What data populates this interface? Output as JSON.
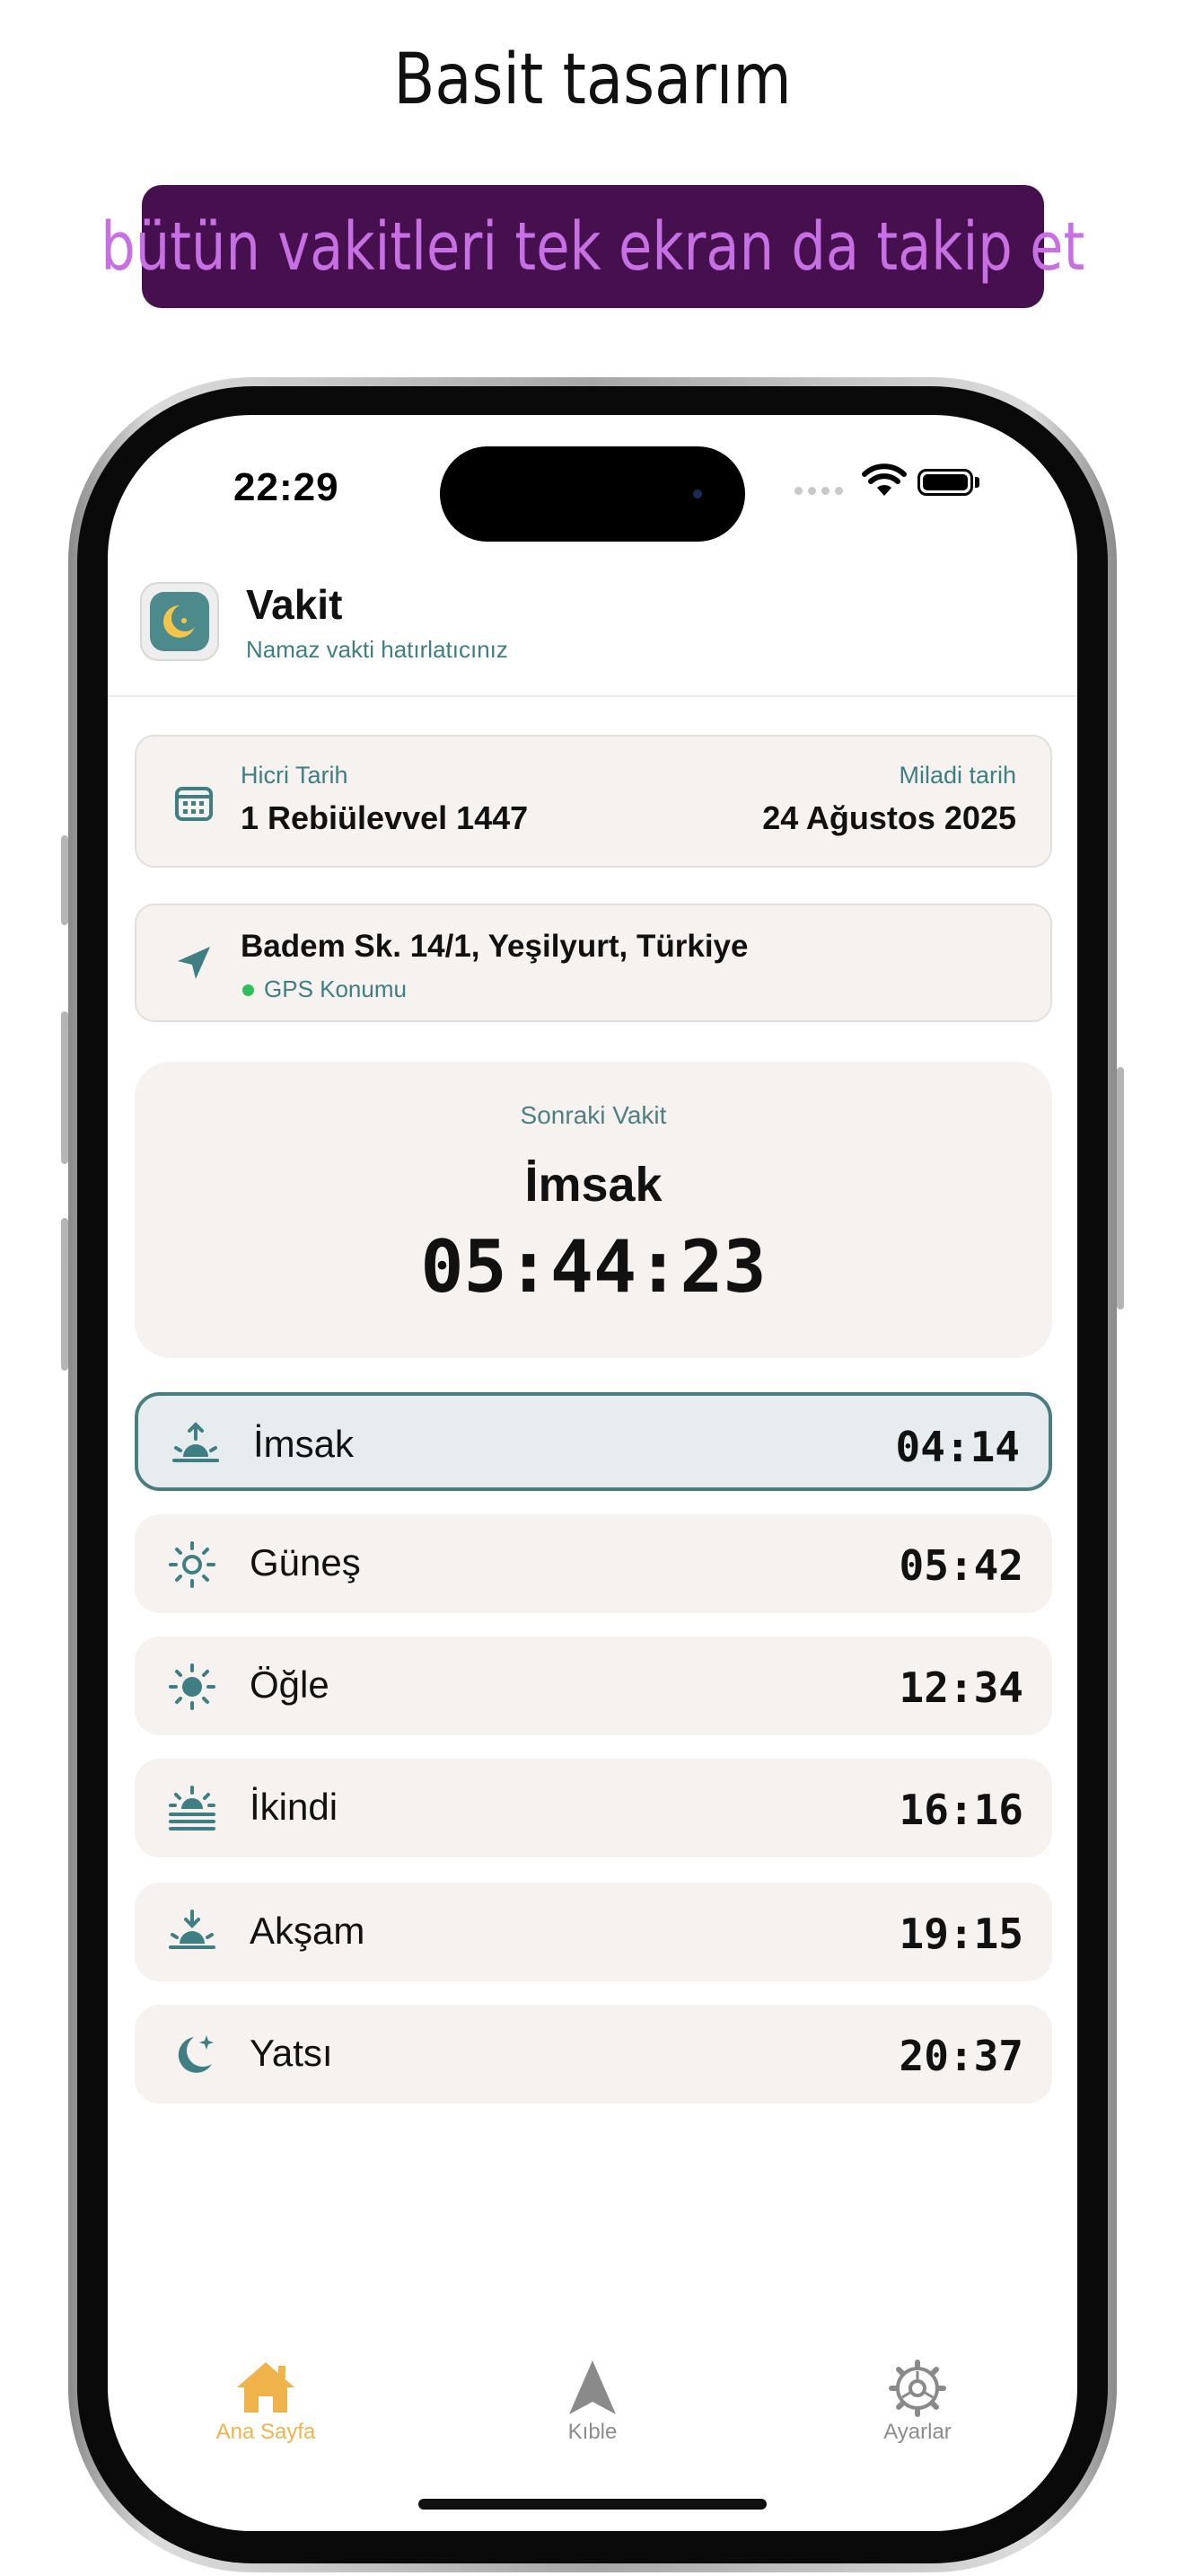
{
  "marketing": {
    "headline": "Basit tasarım",
    "banner": "bütün vakitleri tek ekran da takip et"
  },
  "status_bar": {
    "time": "22:29"
  },
  "app": {
    "title": "Vakit",
    "subtitle": "Namaz vakti hatırlatıcınız"
  },
  "dates": {
    "hijri_label": "Hicri Tarih",
    "hijri_value": "1 Rebiülevvel 1447",
    "gregorian_label": "Miladi tarih",
    "gregorian_value": "24 Ağustos 2025"
  },
  "location": {
    "address": "Badem Sk. 14/1, Yeşilyurt, Türkiye",
    "source": "GPS Konumu"
  },
  "next_prayer": {
    "label": "Sonraki Vakit",
    "name": "İmsak",
    "countdown": "05:44:23"
  },
  "prayers": [
    {
      "name": "İmsak",
      "time": "04:14",
      "icon": "sunrise-up-icon",
      "active": true
    },
    {
      "name": "Güneş",
      "time": "05:42",
      "icon": "sun-outline-icon",
      "active": false
    },
    {
      "name": "Öğle",
      "time": "12:34",
      "icon": "sun-filled-icon",
      "active": false
    },
    {
      "name": "İkindi",
      "time": "16:16",
      "icon": "sun-haze-icon",
      "active": false
    },
    {
      "name": "Akşam",
      "time": "19:15",
      "icon": "sunset-down-icon",
      "active": false
    },
    {
      "name": "Yatsı",
      "time": "20:37",
      "icon": "moon-stars-icon",
      "active": false
    }
  ],
  "tabs": [
    {
      "label": "Ana Sayfa",
      "icon": "home-icon",
      "active": true
    },
    {
      "label": "Kıble",
      "icon": "qibla-arrow-icon",
      "active": false
    },
    {
      "label": "Ayarlar",
      "icon": "gear-icon",
      "active": false
    }
  ],
  "colors": {
    "banner_bg": "#46104f",
    "banner_text": "#c770e4",
    "accent_teal": "#3f7e82",
    "active_tab": "#f0b24a",
    "card_bg": "#f5f2ef",
    "active_row_border": "#4a7d80"
  }
}
